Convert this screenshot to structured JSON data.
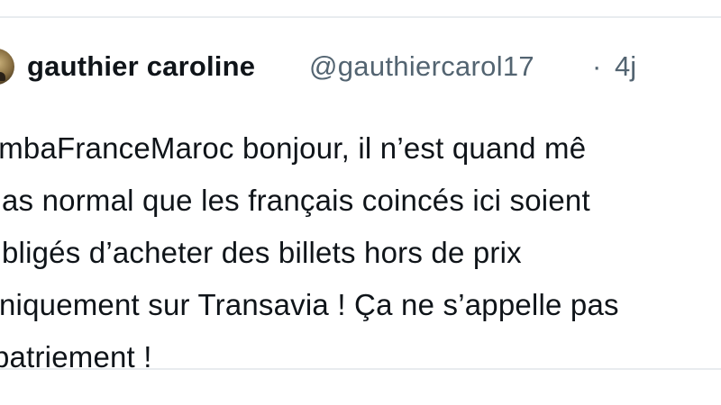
{
  "tweet": {
    "display_name": "gauthier caroline",
    "handle": "@gauthiercarol17",
    "separator": "·",
    "timestamp": "4j",
    "avatar_icon": "profile-photo",
    "text_lines": [
      "AmbaFranceMaroc bonjour, il n’est quand mê",
      "as normal que les français coincés ici soient",
      "bligés d’acheter des billets hors de prix",
      "niquement sur Transavia ! Ça ne s’appelle pas",
      "patriement !"
    ]
  },
  "colors": {
    "text_primary": "#0f1419",
    "text_secondary": "#536471",
    "divider": "#e8ecef"
  }
}
